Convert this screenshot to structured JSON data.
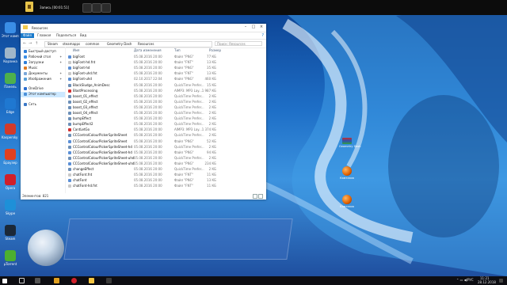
{
  "recorder": {
    "title": "Запись [00:01:51]"
  },
  "window": {
    "title": "Resources",
    "tabs": [
      "Файл",
      "Главная",
      "Поделиться",
      "Вид"
    ],
    "breadcrumbs": [
      "Steam",
      "steamapps",
      "common",
      "Geometry Dash",
      "Resources"
    ],
    "search_placeholder": "Поиск: Resources",
    "columns": [
      "Имя",
      "Дата изменения",
      "Тип",
      "Размер"
    ],
    "nav": [
      {
        "label": "Быстрый доступ",
        "icon": "star-icon"
      },
      {
        "label": "Рабочий стол",
        "icon": "desktop-icon",
        "pinned": true
      },
      {
        "label": "Загрузки",
        "icon": "download-icon",
        "pinned": true
      },
      {
        "label": "Music",
        "icon": "music-icon"
      },
      {
        "label": "Документы",
        "icon": "document-icon",
        "pinned": true
      },
      {
        "label": "Изображения",
        "icon": "pictures-icon",
        "pinned": true
      },
      {
        "label": "OneDrive",
        "icon": "cloud-icon"
      },
      {
        "label": "Этот компьютер",
        "icon": "computer-icon",
        "selected": true
      },
      {
        "label": "Сеть",
        "icon": "network-icon"
      }
    ],
    "files": [
      {
        "name": "bigFont",
        "date": "05.08.2016 20:00",
        "type": "Файл \"PNG\"",
        "size": "77 КБ",
        "icon": "png"
      },
      {
        "name": "bigFont-hd.fnt",
        "date": "05.08.2016 20:00",
        "type": "Файл \"FNT\"",
        "size": "13 КБ",
        "icon": "fnt"
      },
      {
        "name": "bigFont-hd",
        "date": "05.08.2016 20:00",
        "type": "Файл \"PNG\"",
        "size": "35 КБ",
        "icon": "png"
      },
      {
        "name": "bigFont-uhd.fnt",
        "date": "05.08.2016 20:00",
        "type": "Файл \"FNT\"",
        "size": "13 КБ",
        "icon": "fnt"
      },
      {
        "name": "bigFont-uhd",
        "date": "02.10.2017 22:04",
        "type": "Файл \"PNG\"",
        "size": "460 КБ",
        "icon": "png"
      },
      {
        "name": "BlackSludge_AnimDesc",
        "date": "05.08.2016 20:00",
        "type": "QuickTime Prefer...",
        "size": "15 КБ",
        "icon": "qt"
      },
      {
        "name": "BlastProcessing",
        "date": "05.08.2016 20:00",
        "type": "AIMP3: MP3 Lay...",
        "size": "1 987 КБ",
        "icon": "mp3"
      },
      {
        "name": "boost_01_effect",
        "date": "05.08.2016 20:00",
        "type": "QuickTime Prefer...",
        "size": "2 КБ",
        "icon": "qt"
      },
      {
        "name": "boost_02_effect",
        "date": "05.08.2016 20:00",
        "type": "QuickTime Prefer...",
        "size": "2 КБ",
        "icon": "qt"
      },
      {
        "name": "boost_03_effect",
        "date": "05.08.2016 20:00",
        "type": "QuickTime Prefer...",
        "size": "2 КБ",
        "icon": "qt"
      },
      {
        "name": "boost_04_effect",
        "date": "05.08.2016 20:00",
        "type": "QuickTime Prefer...",
        "size": "2 КБ",
        "icon": "qt"
      },
      {
        "name": "bumpEffect",
        "date": "05.08.2016 20:00",
        "type": "QuickTime Prefer...",
        "size": "2 КБ",
        "icon": "qt"
      },
      {
        "name": "bumpEffect2",
        "date": "05.08.2016 20:00",
        "type": "QuickTime Prefer...",
        "size": "2 КБ",
        "icon": "qt"
      },
      {
        "name": "CantLetGo",
        "date": "05.08.2016 20:00",
        "type": "AIMP3: MP3 Lay...",
        "size": "1 374 КБ",
        "icon": "mp3"
      },
      {
        "name": "CCControlColourPickerSpriteSheet",
        "date": "05.08.2016 20:00",
        "type": "QuickTime Prefer...",
        "size": "2 КБ",
        "icon": "qt"
      },
      {
        "name": "CCControlColourPickerSpriteSheet",
        "date": "05.08.2016 20:00",
        "type": "Файл \"PNG\"",
        "size": "52 КБ",
        "icon": "png"
      },
      {
        "name": "CCControlColourPickerSpriteSheet-hd",
        "date": "05.08.2016 20:00",
        "type": "QuickTime Prefer...",
        "size": "2 КБ",
        "icon": "qt"
      },
      {
        "name": "CCControlColourPickerSpriteSheet-hd",
        "date": "05.08.2016 20:00",
        "type": "Файл \"PNG\"",
        "size": "94 КБ",
        "icon": "png"
      },
      {
        "name": "CCControlColourPickerSpriteSheet-uhd",
        "date": "05.08.2016 20:00",
        "type": "QuickTime Prefer...",
        "size": "2 КБ",
        "icon": "qt"
      },
      {
        "name": "CCControlColourPickerSpriteSheet-uhd",
        "date": "05.08.2016 20:00",
        "type": "Файл \"PNG\"",
        "size": "234 КБ",
        "icon": "png"
      },
      {
        "name": "changeEffect",
        "date": "05.08.2016 20:00",
        "type": "QuickTime Prefer...",
        "size": "2 КБ",
        "icon": "qt"
      },
      {
        "name": "chatFont.fnt",
        "date": "05.08.2016 20:00",
        "type": "Файл \"FNT\"",
        "size": "11 КБ",
        "icon": "fnt"
      },
      {
        "name": "chatFont",
        "date": "05.08.2016 20:00",
        "type": "Файл \"PNG\"",
        "size": "13 КБ",
        "icon": "png"
      },
      {
        "name": "chatFont-hd.fnt",
        "date": "05.08.2016 20:00",
        "type": "Файл \"FNT\"",
        "size": "11 КБ",
        "icon": "fnt"
      }
    ],
    "status": "Элементов: 821"
  },
  "desktop_icons": [
    {
      "label": "Этот компьютер",
      "icon": "computer-icon",
      "color": "#3a8ee6"
    },
    {
      "label": "Корзина",
      "icon": "recycle-bin-icon",
      "color": "#9fb6c9"
    },
    {
      "label": "Панель",
      "icon": "control-panel-icon",
      "color": "#4db04d"
    },
    {
      "label": "Edge",
      "icon": "edge-icon",
      "color": "#1f78d1"
    },
    {
      "label": "Kaspersky Free",
      "icon": "kaspersky-icon",
      "color": "#d23a2a"
    },
    {
      "label": "Браузер",
      "icon": "yandex-browser-icon",
      "color": "#e04020"
    },
    {
      "label": "Opera",
      "icon": "opera-icon",
      "color": "#d0202a"
    },
    {
      "label": "Skype",
      "icon": "skype-icon",
      "color": "#1e90d8"
    },
    {
      "label": "Steam",
      "icon": "steam-icon",
      "color": "#1b2838"
    },
    {
      "label": "µTorrent",
      "icon": "utorrent-icon",
      "color": "#4caf30"
    }
  ],
  "right_icons": [
    {
      "label": "Geometry Dash",
      "icon": "flag-icon"
    },
    {
      "label": "Камтазия",
      "icon": "camtasia-icon"
    },
    {
      "label": "Камтазия",
      "icon": "camtasia-icon"
    }
  ],
  "taskbar": {
    "lang": "РУС",
    "time": "11:21",
    "date": "28.12.2018"
  }
}
